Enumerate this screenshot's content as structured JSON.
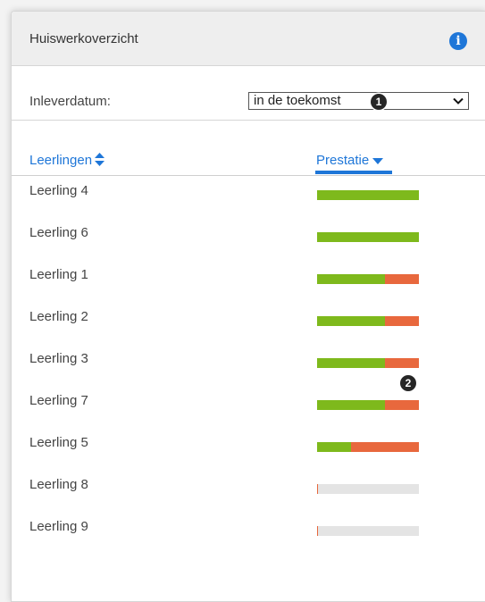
{
  "header": {
    "title": "Huiswerkoverzicht",
    "info_icon": "info-icon"
  },
  "filter": {
    "label": "Inleverdatum:",
    "selected": "in de toekomst",
    "marker": "1"
  },
  "columns": {
    "students_label": "Leerlingen",
    "students_sort_icon": "sort-both-icon",
    "performance_label": "Prestatie",
    "performance_sort_icon": "sort-down-icon"
  },
  "students": [
    {
      "name": "Leerling 4",
      "good": 1.0,
      "bad": 0.0
    },
    {
      "name": "Leerling 6",
      "good": 1.0,
      "bad": 0.0
    },
    {
      "name": "Leerling 1",
      "good": 0.67,
      "bad": 0.33
    },
    {
      "name": "Leerling 2",
      "good": 0.67,
      "bad": 0.33
    },
    {
      "name": "Leerling 3",
      "good": 0.67,
      "bad": 0.33
    },
    {
      "name": "Leerling 7",
      "good": 0.67,
      "bad": 0.33
    },
    {
      "name": "Leerling 5",
      "good": 0.33,
      "bad": 0.67
    },
    {
      "name": "Leerling 8",
      "good": 0.0,
      "bad": 0.0
    },
    {
      "name": "Leerling 9",
      "good": 0.0,
      "bad": 0.0
    }
  ],
  "bar_marker": "2",
  "colors": {
    "accent": "#1e76d8",
    "good": "#7eb91c",
    "bad": "#e8683d",
    "empty": "#e4e4e4"
  }
}
